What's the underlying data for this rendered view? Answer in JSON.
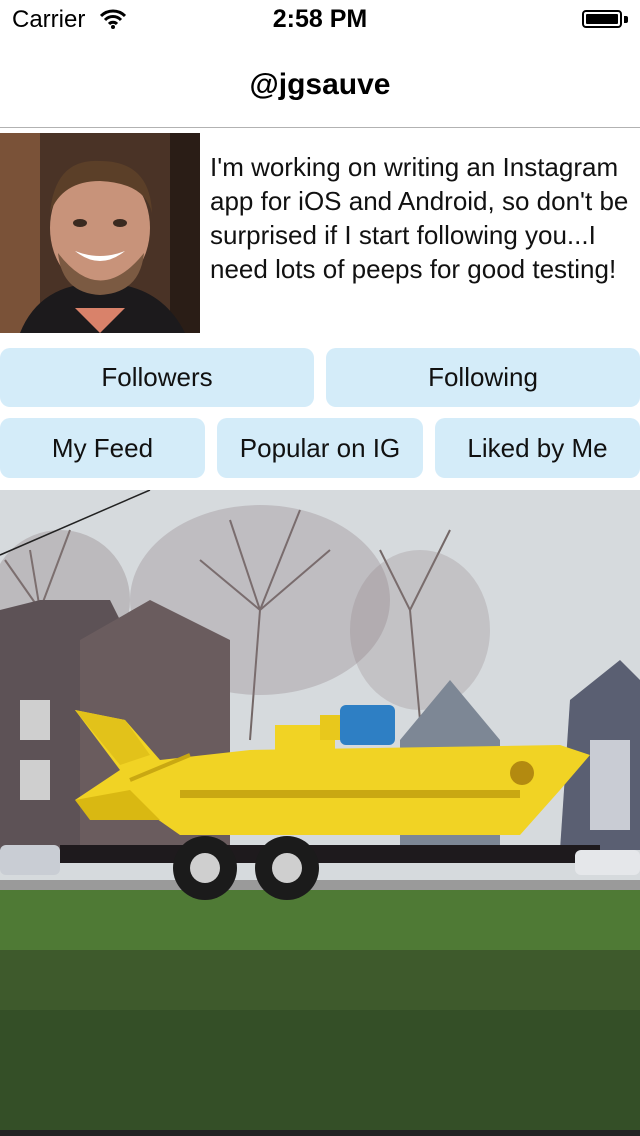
{
  "status_bar": {
    "carrier": "Carrier",
    "time": "2:58 PM",
    "wifi_icon": "wifi-icon",
    "battery_icon": "battery-icon"
  },
  "nav": {
    "title": "@jgsauve"
  },
  "profile": {
    "bio": "I'm working on writing an Instagram app for iOS and Android, so don't be surprised if I start following you...I need lots of peeps for good testing!"
  },
  "buttons": {
    "followers": "Followers",
    "following": "Following",
    "my_feed": "My Feed",
    "popular": "Popular on IG",
    "liked": "Liked by Me"
  },
  "colors": {
    "button_bg": "#d4ecf9",
    "separator": "#b2b2b2"
  }
}
